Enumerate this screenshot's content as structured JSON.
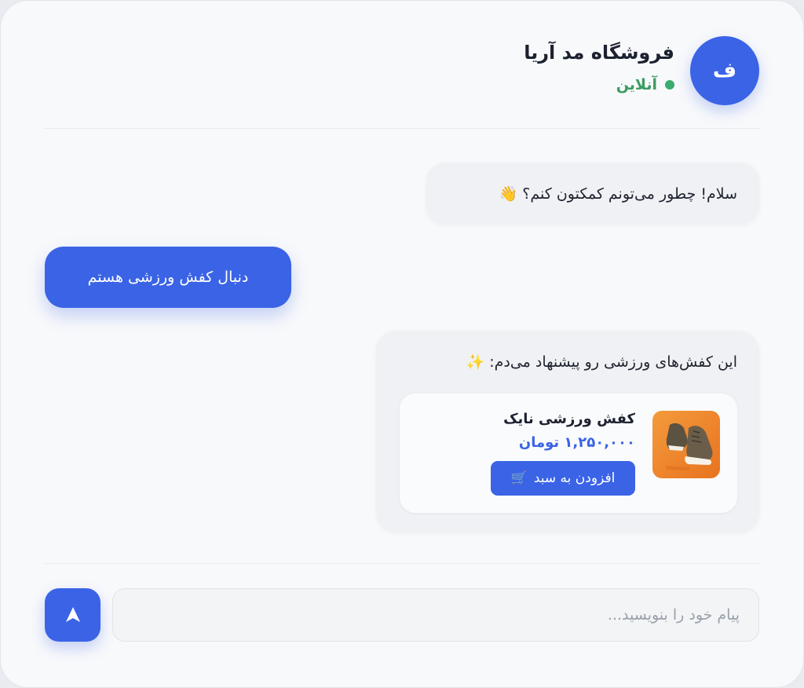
{
  "header": {
    "avatar_letter": "ف",
    "store_name": "فروشگاه مد آریا",
    "status": "آنلاین",
    "status_color": "#3cab6e"
  },
  "messages": {
    "greeting": "سلام! چطور می‌تونم کمکتون کنم؟ 👋",
    "user_request": "دنبال کفش ورزشی هستم",
    "suggestion": "این کفش‌های ورزشی رو پیشنهاد می‌دم: ✨"
  },
  "product": {
    "name": "کفش ورزشی نایک",
    "price": "۱,۲۵۰,۰۰۰ تومان",
    "add_to_cart_label": "افزودن به سبد",
    "cart_icon": "🛒"
  },
  "composer": {
    "placeholder": "پیام خود را بنویسید...",
    "send_icon": "send-icon"
  },
  "colors": {
    "accent": "#3a63e6",
    "background": "#f8f9fb",
    "bot_bubble": "#f0f1f4"
  }
}
